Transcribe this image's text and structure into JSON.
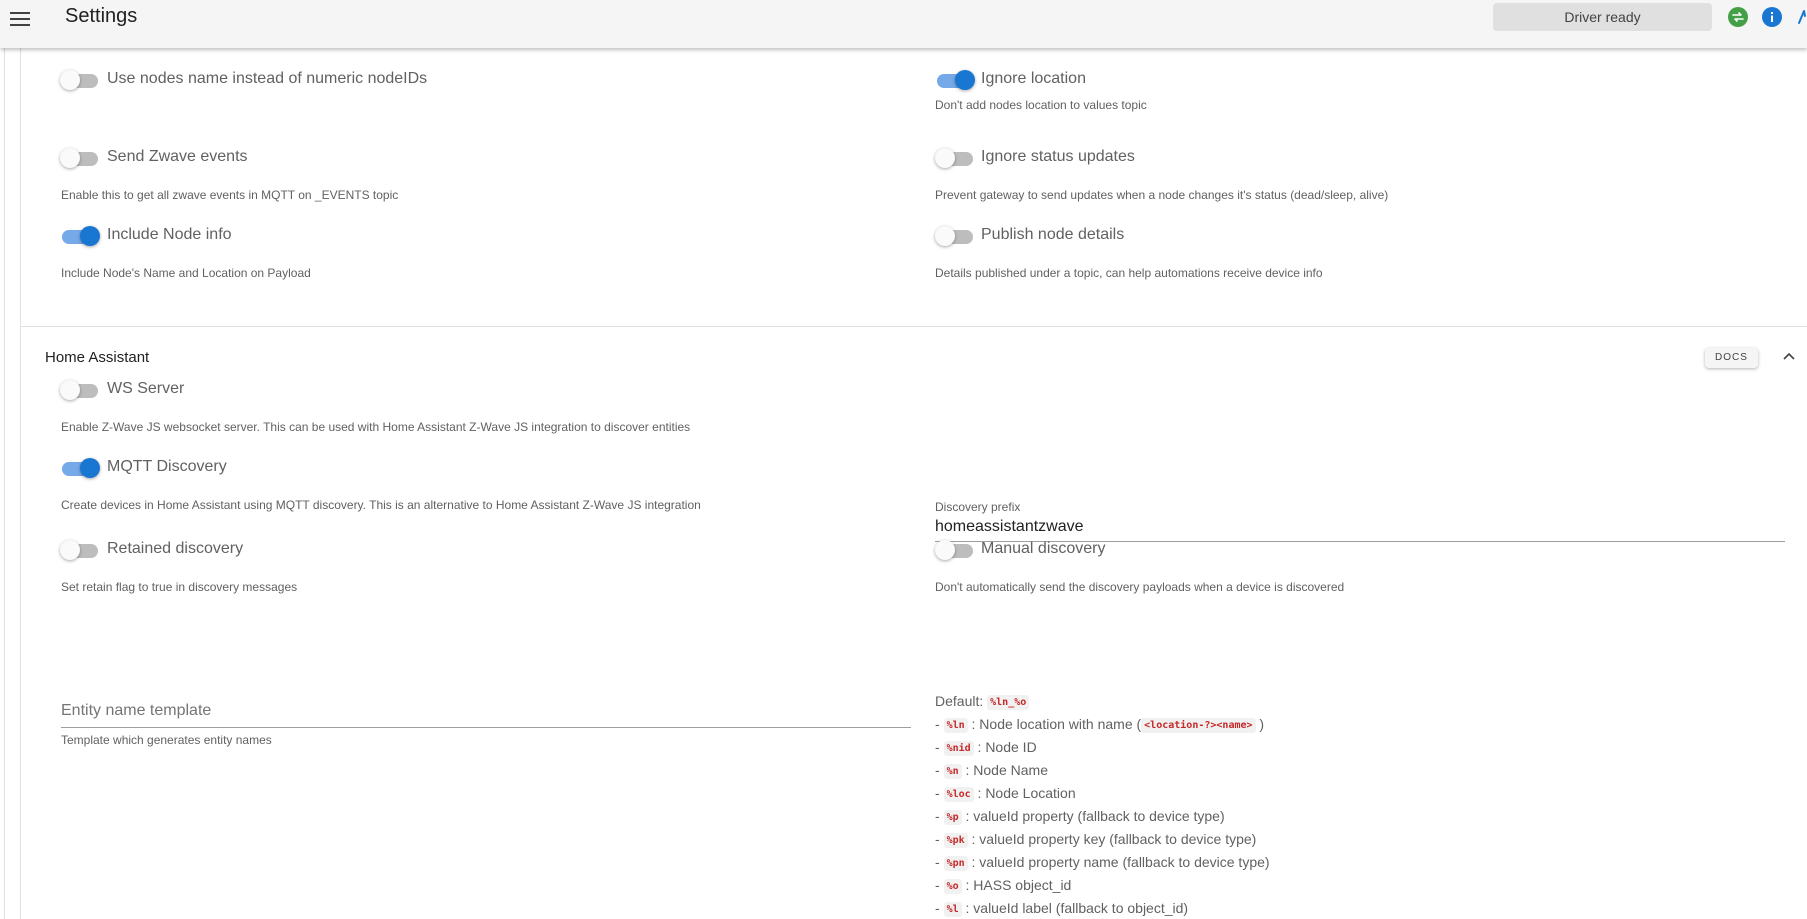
{
  "header": {
    "title": "Settings",
    "status": "Driver ready",
    "icons": [
      "menu-icon",
      "sync-icon",
      "info-icon"
    ]
  },
  "settings": {
    "use_node_names": {
      "label": "Use nodes name instead of numeric nodeIDs",
      "on": false
    },
    "ignore_location": {
      "label": "Ignore location",
      "hint": "Don't add nodes location to values topic",
      "on": true
    },
    "send_zwave_events": {
      "label": "Send Zwave events",
      "hint": "Enable this to get all zwave events in MQTT on _EVENTS topic",
      "on": false
    },
    "ignore_status": {
      "label": "Ignore status updates",
      "hint": "Prevent gateway to send updates when a node changes it's status (dead/sleep, alive)",
      "on": false
    },
    "include_node_info": {
      "label": "Include Node info",
      "hint": "Include Node's Name and Location on Payload",
      "on": true
    },
    "publish_node_details": {
      "label": "Publish node details",
      "hint": "Details published under a topic, can help automations receive device info",
      "on": false
    }
  },
  "home_assistant": {
    "title": "Home Assistant",
    "docs_label": "DOCS",
    "ws_server": {
      "label": "WS Server",
      "hint": "Enable Z-Wave JS websocket server. This can be used with Home Assistant Z-Wave JS integration to discover entities",
      "on": false
    },
    "mqtt_discovery": {
      "label": "MQTT Discovery",
      "hint": "Create devices in Home Assistant using MQTT discovery. This is an alternative to Home Assistant Z-Wave JS integration",
      "on": true
    },
    "discovery_prefix": {
      "label": "Discovery prefix",
      "value": "homeassistantzwave"
    },
    "retained_discovery": {
      "label": "Retained discovery",
      "hint": "Set retain flag to true in discovery messages",
      "on": false
    },
    "manual_discovery": {
      "label": "Manual discovery",
      "hint": "Don't automatically send the discovery payloads when a device is discovered",
      "on": false
    },
    "entity_template": {
      "placeholder": "Entity name template",
      "hint": "Template which generates entity names",
      "value": ""
    },
    "template_help": {
      "default_label": "Default:",
      "default_code": "%ln_%o",
      "items": [
        {
          "code": "%ln",
          "text": ": Node location with name (",
          "extra_code": "<location-?><name>",
          "after": ")"
        },
        {
          "code": "%nid",
          "text": ": Node ID"
        },
        {
          "code": "%n",
          "text": ": Node Name"
        },
        {
          "code": "%loc",
          "text": ": Node Location"
        },
        {
          "code": "%p",
          "text": ": valueId property (fallback to device type)"
        },
        {
          "code": "%pk",
          "text": ": valueId property key (fallback to device type)"
        },
        {
          "code": "%pn",
          "text": ": valueId property name (fallback to device type)"
        },
        {
          "code": "%o",
          "text": ": HASS object_id"
        },
        {
          "code": "%l",
          "text": ": valueId label (fallback to object_id)"
        }
      ]
    }
  },
  "colors": {
    "accent": "#1976d2",
    "track_on": "#76a9e8",
    "status_green": "#43a047"
  }
}
